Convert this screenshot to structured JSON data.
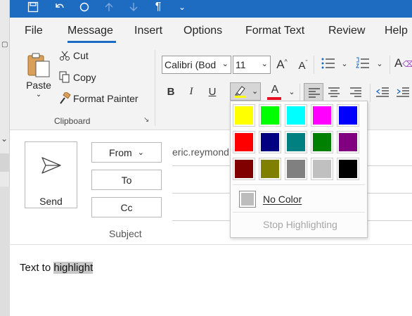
{
  "colors": {
    "title_bar": "#1e6bc2",
    "accent": "#1e6bc2",
    "highlight_yellow": "#ffff00",
    "font_red": "#e81123"
  },
  "ribbon": {
    "tabs": [
      {
        "label": "File"
      },
      {
        "label": "Message"
      },
      {
        "label": "Insert"
      },
      {
        "label": "Options"
      },
      {
        "label": "Format Text"
      },
      {
        "label": "Review"
      },
      {
        "label": "Help"
      }
    ],
    "active_tab": "Message",
    "clipboard": {
      "paste_label": "Paste",
      "cut_label": "Cut",
      "copy_label": "Copy",
      "format_painter_label": "Format Painter",
      "group_label": "Clipboard"
    },
    "font": {
      "font_name": "Calibri (Bod",
      "font_size": "11"
    }
  },
  "compose": {
    "send_label": "Send",
    "from_label": "From",
    "from_value": "eric.reymond",
    "to_label": "To",
    "cc_label": "Cc",
    "subject_label": "Subject",
    "body_plain": "Text to ",
    "body_highlighted": "highlight"
  },
  "highlight_menu": {
    "swatches": [
      {
        "name": "Yellow",
        "color": "#ffff00"
      },
      {
        "name": "Bright Green",
        "color": "#00ff00"
      },
      {
        "name": "Turquoise",
        "color": "#00ffff"
      },
      {
        "name": "Pink",
        "color": "#ff00ff"
      },
      {
        "name": "Blue",
        "color": "#0000ff"
      },
      {
        "name": "Red",
        "color": "#ff0000"
      },
      {
        "name": "Dark Blue",
        "color": "#000080"
      },
      {
        "name": "Teal",
        "color": "#008080"
      },
      {
        "name": "Green",
        "color": "#008000"
      },
      {
        "name": "Violet",
        "color": "#800080"
      },
      {
        "name": "Dark Red",
        "color": "#800000"
      },
      {
        "name": "Dark Yellow",
        "color": "#808000"
      },
      {
        "name": "Gray 50%",
        "color": "#808080"
      },
      {
        "name": "Gray 25%",
        "color": "#c0c0c0"
      },
      {
        "name": "Black",
        "color": "#000000"
      }
    ],
    "no_color_label": "No Color",
    "stop_highlighting_label": "Stop Highlighting"
  }
}
